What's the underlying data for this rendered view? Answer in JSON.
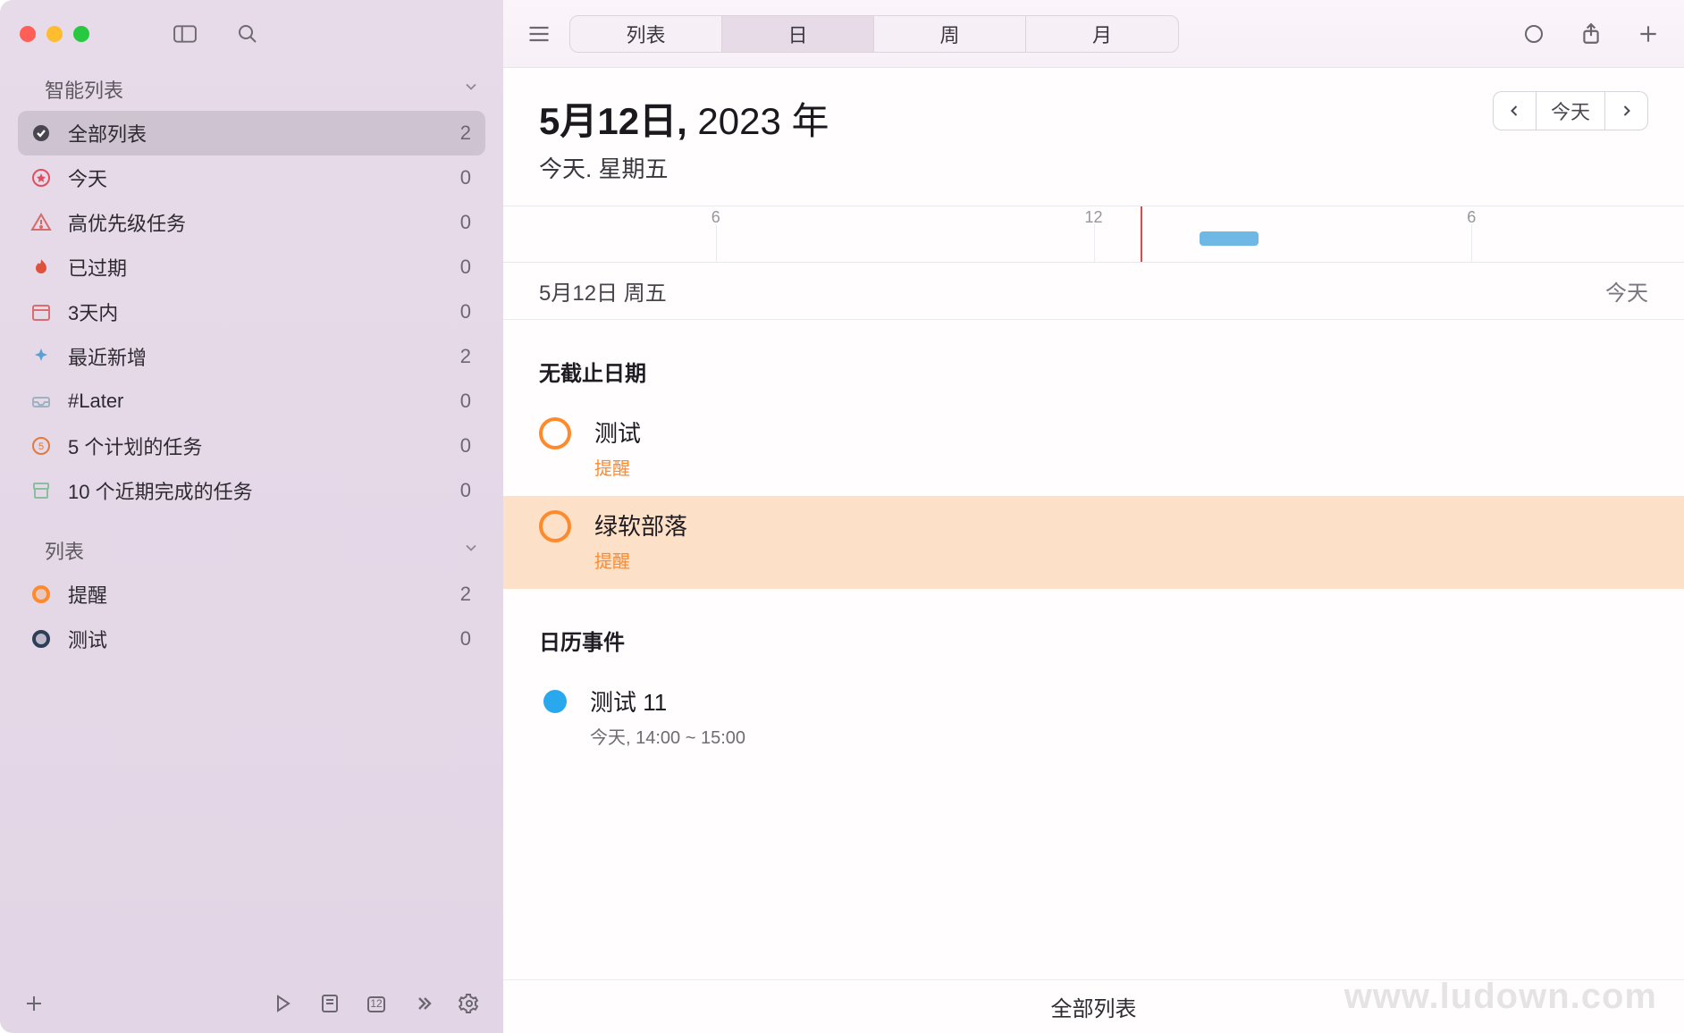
{
  "sidebar": {
    "sections": {
      "smart": {
        "title": "智能列表"
      },
      "lists": {
        "title": "列表"
      }
    },
    "smart_items": [
      {
        "label": "全部列表",
        "count": "2",
        "icon": "check-circle",
        "color": "#4a4650"
      },
      {
        "label": "今天",
        "count": "0",
        "icon": "star",
        "color": "#e04f5f"
      },
      {
        "label": "高优先级任务",
        "count": "0",
        "icon": "warning",
        "color": "#d66a6a"
      },
      {
        "label": "已过期",
        "count": "0",
        "icon": "flame",
        "color": "#e0513a"
      },
      {
        "label": "3天内",
        "count": "0",
        "icon": "calendar",
        "color": "#d76e72"
      },
      {
        "label": "最近新增",
        "count": "2",
        "icon": "sparkle",
        "color": "#5aa0d8"
      },
      {
        "label": "#Later",
        "count": "0",
        "icon": "tray",
        "color": "#9fb2c2"
      },
      {
        "label": "5 个计划的任务",
        "count": "0",
        "icon": "badge5",
        "color": "#e07a3e"
      },
      {
        "label": "10 个近期完成的任务",
        "count": "0",
        "icon": "archive",
        "color": "#8abf9d"
      }
    ],
    "list_items": [
      {
        "label": "提醒",
        "count": "2",
        "color": "#ff8a2c"
      },
      {
        "label": "测试",
        "count": "0",
        "color": "#2e3e58"
      }
    ]
  },
  "toolbar": {
    "segments": [
      "列表",
      "日",
      "周",
      "月"
    ],
    "active_index": 1
  },
  "date_header": {
    "main_bold": "5月12日,",
    "main_light": " 2023 年",
    "sub": "今天. 星期五",
    "today_btn": "今天"
  },
  "timeline": {
    "hours": [
      {
        "label": "6",
        "pct": 18
      },
      {
        "label": "12",
        "pct": 50
      },
      {
        "label": "6",
        "pct": 82
      }
    ],
    "now_pct": 54,
    "task_pct": 59,
    "task_width_pct": 5
  },
  "datebar": {
    "left": "5月12日 周五",
    "right": "今天"
  },
  "sections": {
    "no_deadline": "无截止日期",
    "calendar_events": "日历事件"
  },
  "tasks": [
    {
      "title": "测试",
      "sub": "提醒",
      "highlighted": false
    },
    {
      "title": "绿软部落",
      "sub": "提醒",
      "highlighted": true
    }
  ],
  "events": [
    {
      "title": "测试 11",
      "sub": "今天, 14:00 ~ 15:00"
    }
  ],
  "footer_label": "全部列表",
  "watermark": "www.ludown.com"
}
